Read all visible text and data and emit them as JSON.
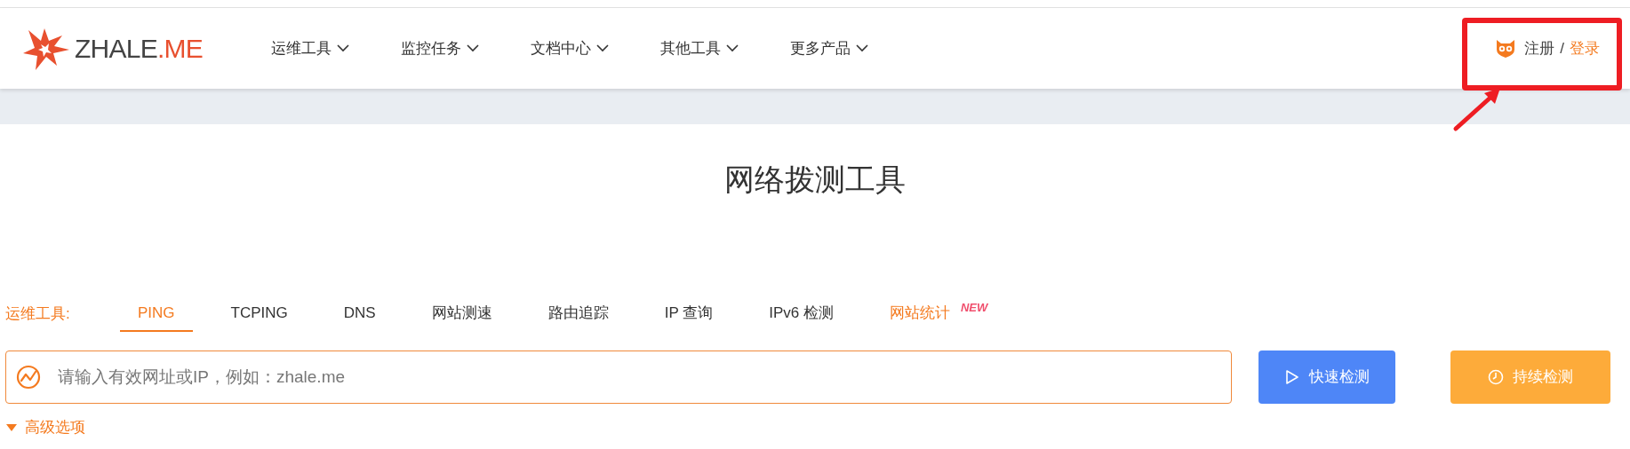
{
  "header": {
    "logo": {
      "primary": "ZHALE",
      "accent": ".ME"
    },
    "nav": [
      {
        "label": "运维工具"
      },
      {
        "label": "监控任务"
      },
      {
        "label": "文档中心"
      },
      {
        "label": "其他工具"
      },
      {
        "label": "更多产品"
      }
    ],
    "auth": {
      "register": "注册",
      "separator": "/",
      "login": "登录"
    }
  },
  "title": "网络拨测工具",
  "tools": {
    "label": "运维工具:",
    "tabs": [
      {
        "label": "PING",
        "selected": true,
        "kind": "tab"
      },
      {
        "label": "TCPING",
        "selected": false,
        "kind": "tab"
      },
      {
        "label": "DNS",
        "selected": false,
        "kind": "tab"
      },
      {
        "label": "网站测速",
        "selected": false,
        "kind": "tab"
      },
      {
        "label": "路由追踪",
        "selected": false,
        "kind": "tab"
      },
      {
        "label": "IP 查询",
        "selected": false,
        "kind": "tab"
      },
      {
        "label": "IPv6 检测",
        "selected": false,
        "kind": "tab"
      },
      {
        "label": "网站统计",
        "selected": false,
        "kind": "featured",
        "badge": "NEW"
      }
    ]
  },
  "search": {
    "placeholder": "请输入有效网址或IP，例如：zhale.me"
  },
  "buttons": [
    {
      "label": "快速检测",
      "kind": "quick"
    },
    {
      "label": "持续检测",
      "kind": "continuous"
    }
  ],
  "advanced": {
    "label": "高级选项",
    "expanded": false
  }
}
